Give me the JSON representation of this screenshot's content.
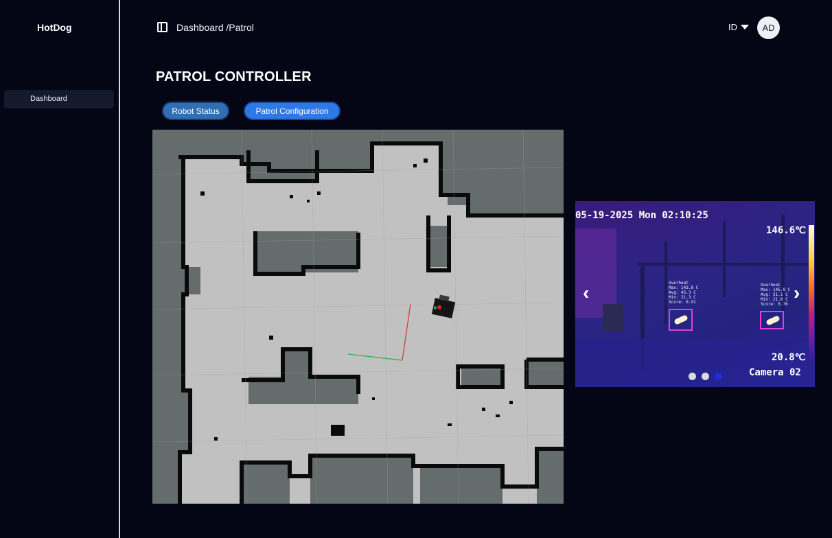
{
  "sidebar": {
    "brand": "HotDog",
    "items": [
      {
        "label": "Dashboard"
      }
    ]
  },
  "header": {
    "breadcrumb": "Dashboard /Patrol",
    "language": "ID",
    "avatar_initials": "AD"
  },
  "main": {
    "title": "PATROL CONTROLLER",
    "buttons": {
      "robot_status": "Robot Status",
      "patrol_configuration": "Patrol Configuration"
    }
  },
  "camera": {
    "timestamp": "05-19-2025 Mon 02:10:25",
    "max_temp": "146.6℃",
    "min_temp": "20.8℃",
    "name": "Camera 02",
    "detections": [
      {
        "text": "Overheat\nMax: 143.8 C\nAvg: 45.3 C\nMin: 21.3 C\nScore: 0.91"
      },
      {
        "text": "Overheat\nMax: 145.9 C\nAvg: 51.1 C\nMin: 21.8 C\nScore: 0.76"
      }
    ],
    "carousel": {
      "count": 3,
      "active_index": 2
    }
  },
  "colors": {
    "background": "#040616",
    "button_status": "#2f6fb5",
    "button_patrol": "#2d79e6",
    "carousel_active": "#1f2bd6",
    "map_free": "#c1c1c1",
    "map_unknown": "#646d6b",
    "map_wall": "#0a0a0a"
  },
  "icons": {
    "sidebar_toggle": "sidebar-toggle-icon",
    "language_caret": "chevron-down-icon",
    "carousel_prev": "chevron-left-icon",
    "carousel_next": "chevron-right-icon"
  }
}
